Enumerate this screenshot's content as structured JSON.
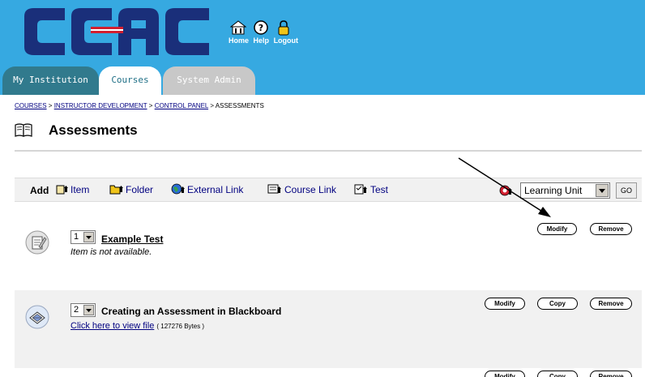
{
  "header": {
    "logo_text": "CCAC",
    "top_links": [
      "Home",
      "Help",
      "Logout"
    ],
    "tabs": [
      "My Institution",
      "Courses",
      "System Admin"
    ],
    "active_tab": "Courses",
    "colors": {
      "header_bg": "#36a9e1",
      "logo_navy": "#1a2f7a",
      "logo_red": "#d22030"
    }
  },
  "breadcrumb": {
    "links": [
      "COURSES",
      "INSTRUCTOR DEVELOPMENT",
      "CONTROL PANEL"
    ],
    "current": "ASSESSMENTS",
    "separator": ">"
  },
  "page": {
    "title": "Assessments",
    "icon": "open-book-icon"
  },
  "actionbar": {
    "add_label": "Add",
    "buttons": [
      {
        "label": "Item",
        "icon": "add-item-icon"
      },
      {
        "label": "Folder",
        "icon": "add-folder-icon"
      },
      {
        "label": "External Link",
        "icon": "add-external-link-icon"
      },
      {
        "label": "Course Link",
        "icon": "add-course-link-icon"
      },
      {
        "label": "Test",
        "icon": "add-test-icon"
      }
    ],
    "select_value": "Learning Unit",
    "go_label": "GO"
  },
  "items": [
    {
      "order": "1",
      "title": "Example Test",
      "subtitle": "Item is not available.",
      "buttons": [
        "Modify",
        "Remove"
      ],
      "icon": "test-item-icon"
    },
    {
      "order": "2",
      "title": "Creating an Assessment in Blackboard",
      "file_link": "Click here to view file",
      "file_size": "( 127276 Bytes )",
      "buttons": [
        "Modify",
        "Copy",
        "Remove"
      ],
      "icon": "document-item-icon"
    },
    {
      "buttons": [
        "Modify",
        "Copy",
        "Remove"
      ]
    }
  ]
}
